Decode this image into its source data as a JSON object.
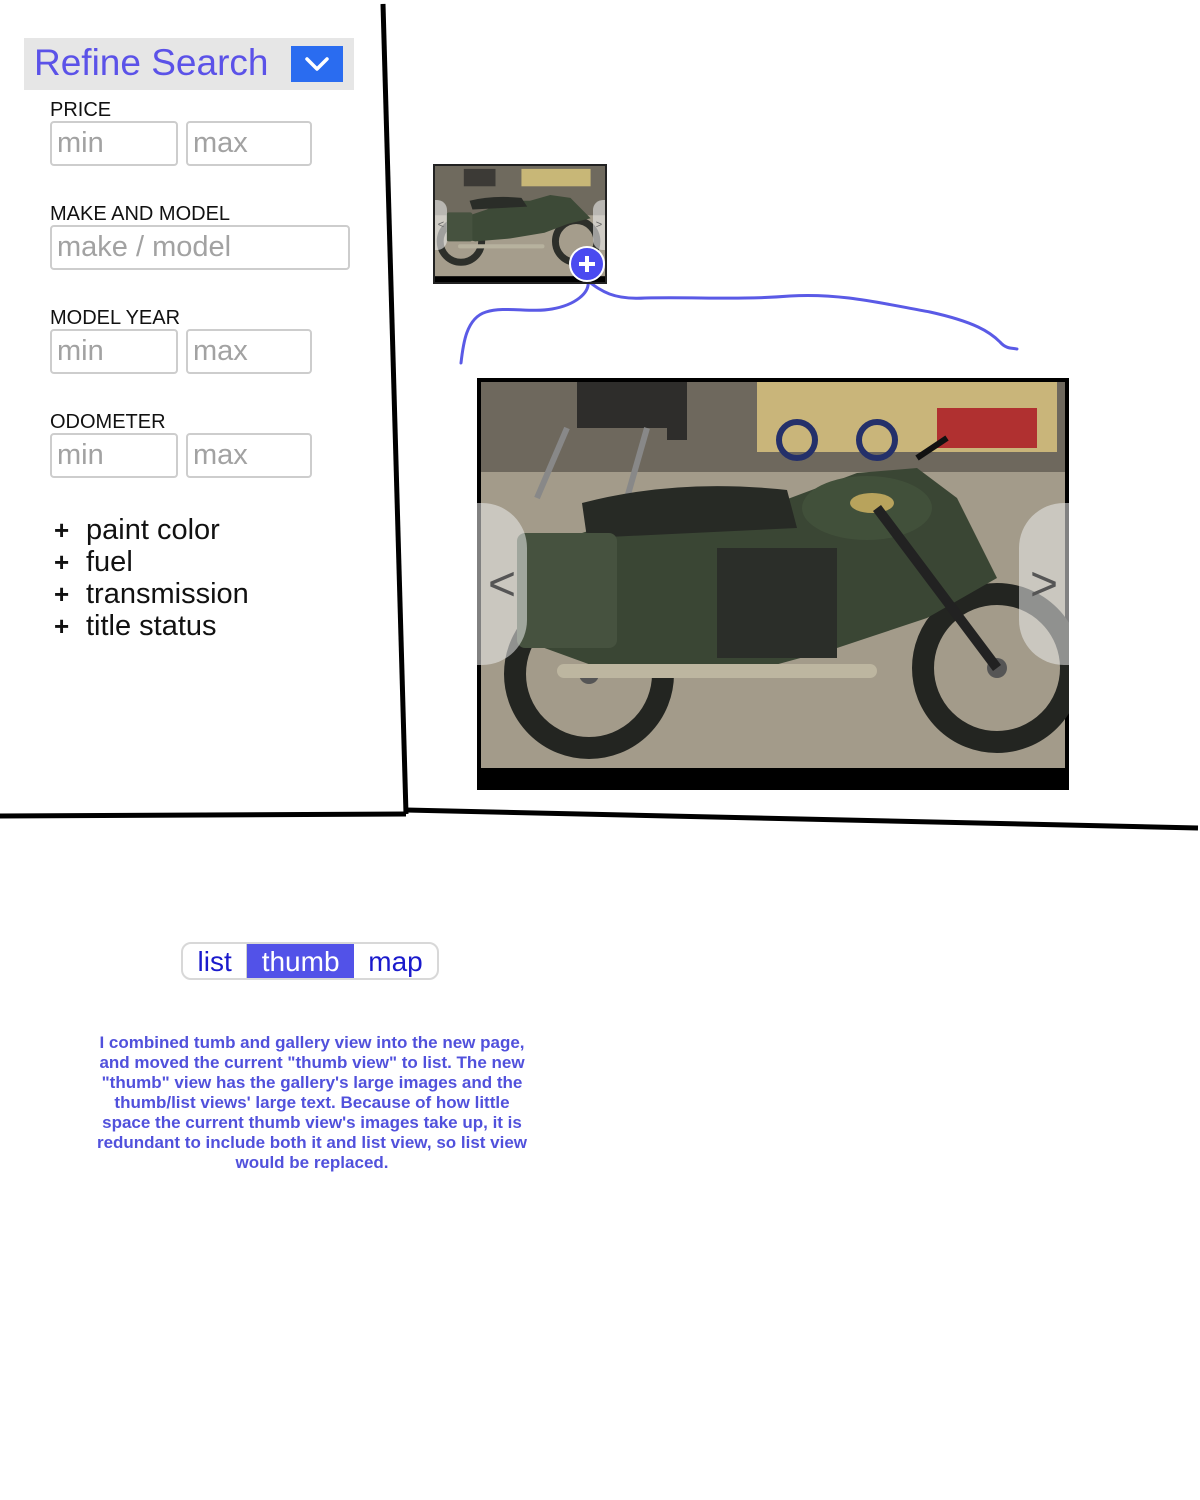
{
  "refine": {
    "title": "Refine Search",
    "toggle_icon": "chevron-down-icon"
  },
  "filters": {
    "price": {
      "label": "PRICE",
      "min_placeholder": "min",
      "max_placeholder": "max"
    },
    "make_model": {
      "label": "MAKE AND MODEL",
      "placeholder": "make / model"
    },
    "model_year": {
      "label": "MODEL YEAR",
      "min_placeholder": "min",
      "max_placeholder": "max"
    },
    "odometer": {
      "label": "ODOMETER",
      "min_placeholder": "min",
      "max_placeholder": "max"
    }
  },
  "facets": [
    {
      "symbol": "+",
      "label": "paint color"
    },
    {
      "symbol": "+",
      "label": "fuel"
    },
    {
      "symbol": "+",
      "label": "transmission"
    },
    {
      "symbol": "+",
      "label": "title status"
    }
  ],
  "gallery": {
    "prev": "<",
    "next": ">",
    "thumb_prev": "<",
    "thumb_next": ">"
  },
  "view_toggle": {
    "list": "list",
    "thumb": "thumb",
    "map": "map",
    "selected": "thumb"
  },
  "note": "I combined tumb and gallery view into the new page, and moved the current \"thumb view\" to list. The new \"thumb\" view has the gallery's large images and the thumb/list views' large text. Because of how little space the current thumb view's images take up, it is redundant to include both it and list view, so list view would be replaced.",
  "colors": {
    "accent": "#5b52e8",
    "toggle_blue": "#2a6cf0",
    "note_text": "#5151dc",
    "annotation_line": "#5a5ae6"
  }
}
